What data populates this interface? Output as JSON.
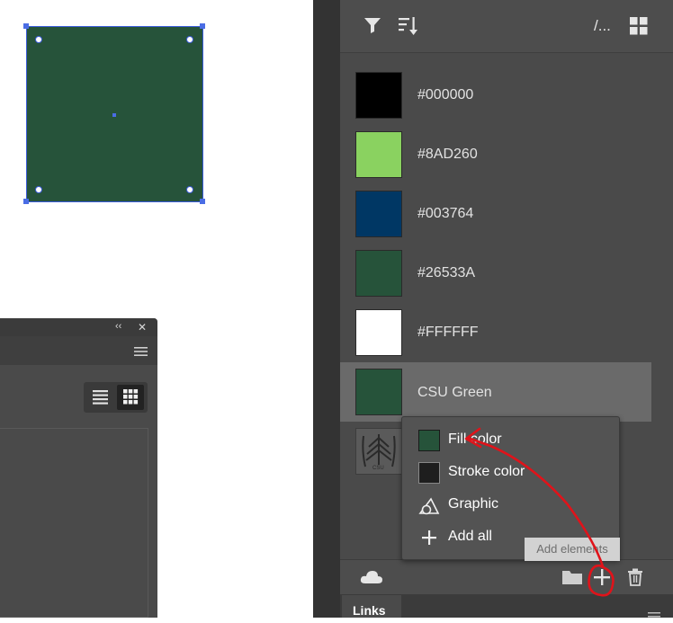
{
  "canvas": {
    "artwork_fill": "#26533A"
  },
  "float_panel": {
    "collapse_glyph": "‹‹",
    "close_glyph": "✕",
    "menu_glyph": "☰"
  },
  "library_panel": {
    "toolbar": {
      "filter_icon": "filter-icon",
      "sort_icon": "sort-icon",
      "path_text": "/...",
      "grid_icon": "grid-view-icon"
    },
    "swatches": [
      {
        "label": "#000000",
        "color": "#000000"
      },
      {
        "label": "#8AD260",
        "color": "#8AD260"
      },
      {
        "label": "#003764",
        "color": "#003764"
      },
      {
        "label": "#26533A",
        "color": "#26533A"
      },
      {
        "label": "#FFFFFF",
        "color": "#FFFFFF"
      },
      {
        "label": "CSU Green",
        "color": "#26533A",
        "selected": true
      }
    ],
    "graphic_text": "CSU",
    "add_menu": {
      "items": [
        {
          "label": "Fill color",
          "icon": "fill-swatch-icon",
          "swatch": "#26533A"
        },
        {
          "label": "Stroke color",
          "icon": "stroke-swatch-icon",
          "swatch": "#1e1e1e"
        },
        {
          "label": "Graphic",
          "icon": "graphic-shapes-icon"
        },
        {
          "label": "Add all",
          "icon": "plus-icon"
        }
      ]
    },
    "tooltip": "Add elements",
    "footer": {
      "cloud_icon": "cloud-icon",
      "folder_icon": "folder-icon",
      "add_icon": "plus-icon",
      "delete_icon": "trash-icon"
    },
    "tabs": [
      {
        "label": "Links"
      }
    ]
  },
  "annotation_color": "#e0131a"
}
